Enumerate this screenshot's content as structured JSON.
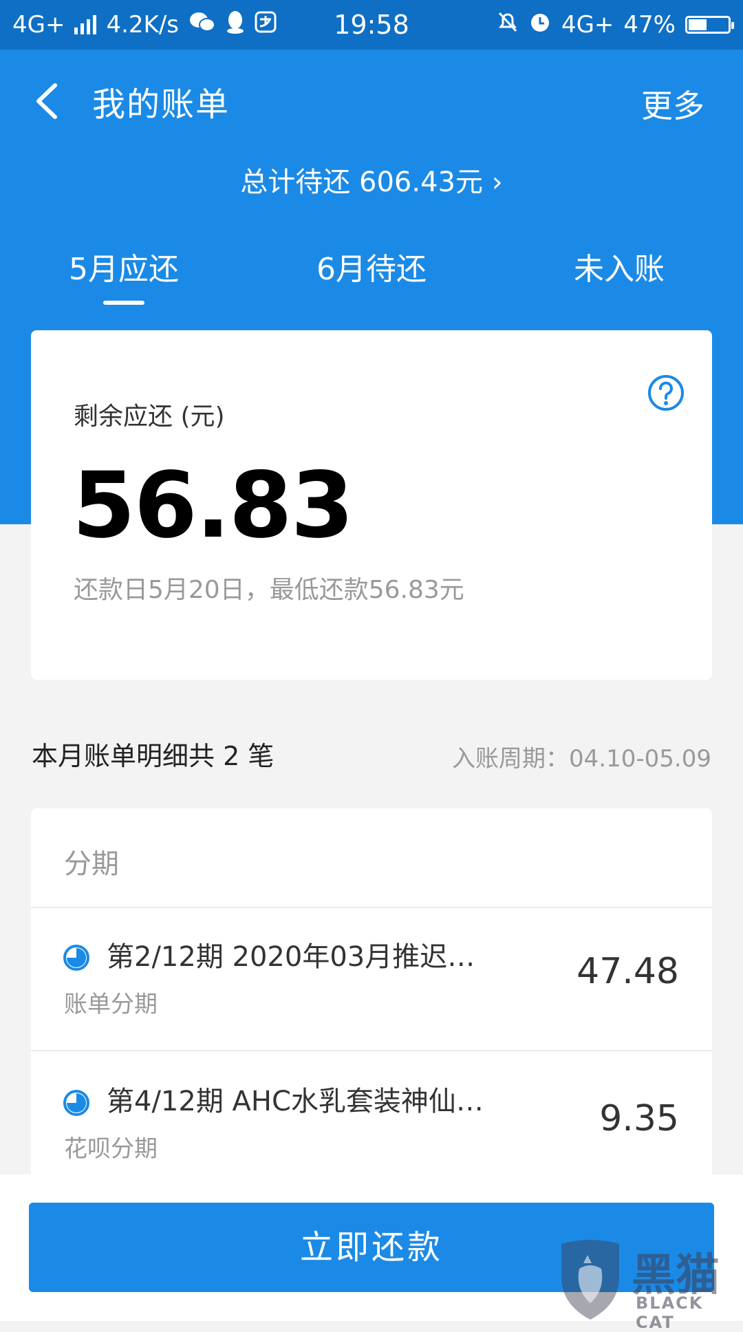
{
  "status_bar": {
    "network_left": "4G+",
    "speed": "4.2K/s",
    "time": "19:58",
    "network_right": "4G+",
    "battery": "47%",
    "battery_fraction": 0.47
  },
  "header": {
    "title": "我的账单",
    "more_label": "更多",
    "total_due": "总计待还 606.43元",
    "total_chevron": "›"
  },
  "tabs": [
    {
      "label": "5月应还",
      "active": true
    },
    {
      "label": "6月待还",
      "active": false
    },
    {
      "label": "未入账",
      "active": false
    }
  ],
  "summary": {
    "remain_label": "剩余应还 (元)",
    "remain_amount": "56.83",
    "due_text": "还款日5月20日，最低还款56.83元"
  },
  "details": {
    "title": "本月账单明细共 2 笔",
    "period": "入账周期：04.10-05.09",
    "section_title": "分期",
    "items": [
      {
        "title": "第2/12期 2020年03月推迟…",
        "subtitle": "账单分期",
        "amount": "47.48"
      },
      {
        "title": "第4/12期 AHC水乳套装神仙…",
        "subtitle": "花呗分期",
        "amount": "9.35"
      }
    ]
  },
  "pay_button": "立即还款",
  "watermark": {
    "main": "黑猫",
    "sub": "BLACK CAT"
  },
  "colors": {
    "primary": "#1b8ae6",
    "status_bar": "#0f6fc4",
    "background": "#f3f3f3"
  }
}
